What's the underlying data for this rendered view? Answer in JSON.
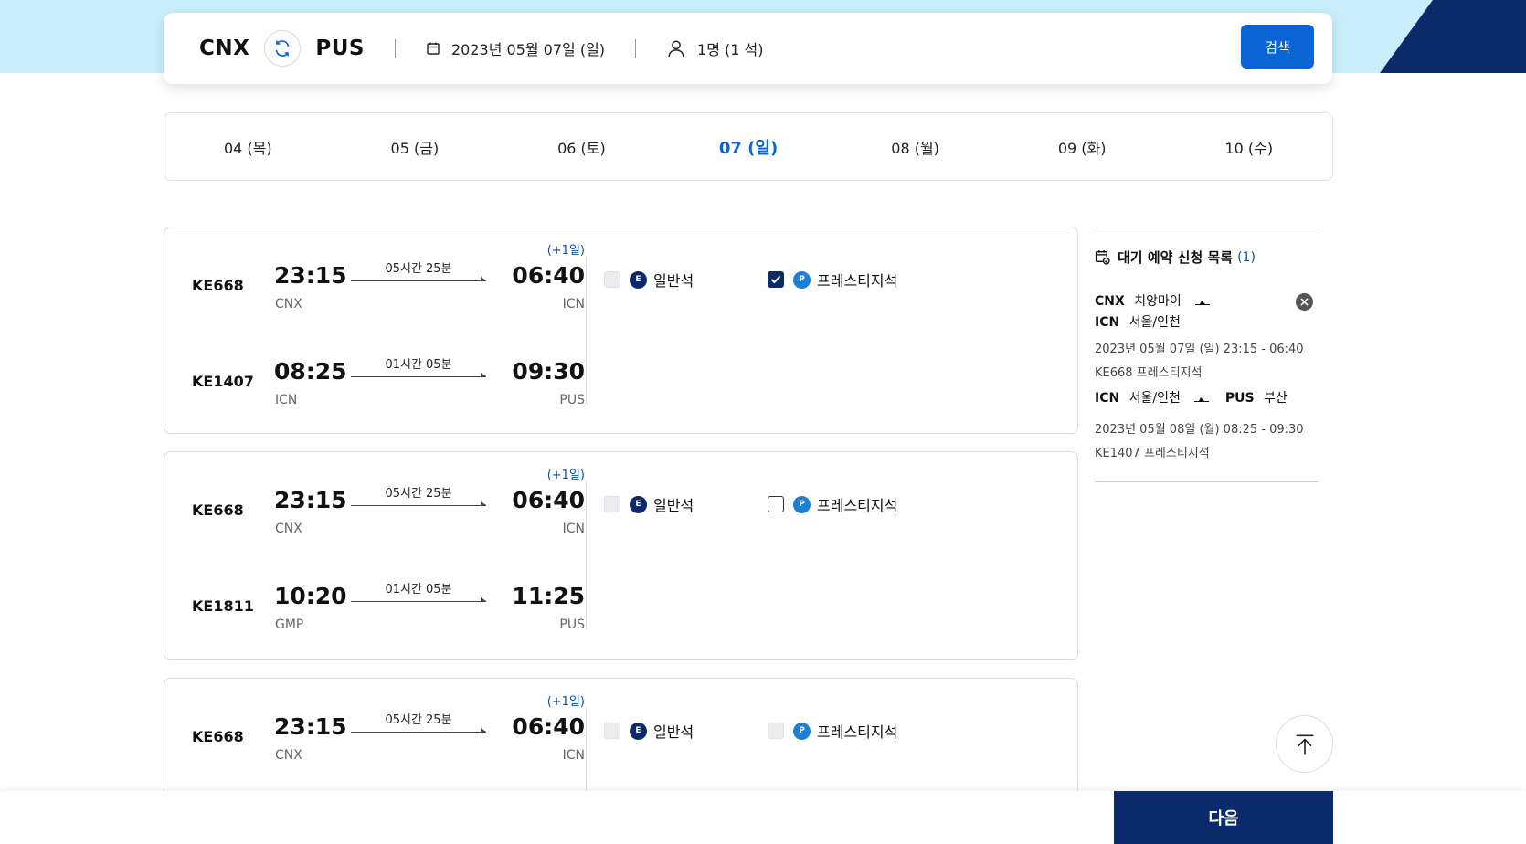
{
  "search": {
    "origin": "CNX",
    "destination": "PUS",
    "date": "2023년 05월 07일 (일)",
    "passengers": "1명 (1 석)",
    "search_label": "검색"
  },
  "date_tabs": [
    {
      "label": "04 (목)",
      "active": false
    },
    {
      "label": "05 (금)",
      "active": false
    },
    {
      "label": "06 (토)",
      "active": false
    },
    {
      "label": "07 (일)",
      "active": true
    },
    {
      "label": "08 (월)",
      "active": false
    },
    {
      "label": "09 (화)",
      "active": false
    },
    {
      "label": "10 (수)",
      "active": false
    }
  ],
  "itineraries": [
    {
      "segments": [
        {
          "flight": "KE668",
          "dep_time": "23:15",
          "dep_code": "CNX",
          "duration": "05시간 25분",
          "arr_time": "06:40",
          "arr_code": "ICN",
          "plus_day": "(+1일)"
        },
        {
          "flight": "KE1407",
          "dep_time": "08:25",
          "dep_code": "ICN",
          "duration": "01시간 05분",
          "arr_time": "09:30",
          "arr_code": "PUS",
          "plus_day": ""
        }
      ],
      "economy": {
        "badge": "E",
        "label": "일반석",
        "state": "disabled"
      },
      "prestige": {
        "badge": "P",
        "label": "프레스티지석",
        "state": "checked"
      }
    },
    {
      "segments": [
        {
          "flight": "KE668",
          "dep_time": "23:15",
          "dep_code": "CNX",
          "duration": "05시간 25분",
          "arr_time": "06:40",
          "arr_code": "ICN",
          "plus_day": "(+1일)"
        },
        {
          "flight": "KE1811",
          "dep_time": "10:20",
          "dep_code": "GMP",
          "duration": "01시간 05분",
          "arr_time": "11:25",
          "arr_code": "PUS",
          "plus_day": ""
        }
      ],
      "economy": {
        "badge": "E",
        "label": "일반석",
        "state": "disabled"
      },
      "prestige": {
        "badge": "P",
        "label": "프레스티지석",
        "state": "empty"
      }
    },
    {
      "segments": [
        {
          "flight": "KE668",
          "dep_time": "23:15",
          "dep_code": "CNX",
          "duration": "05시간 25분",
          "arr_time": "06:40",
          "arr_code": "ICN",
          "plus_day": "(+1일)"
        }
      ],
      "economy": {
        "badge": "E",
        "label": "일반석",
        "state": "disabled"
      },
      "prestige": {
        "badge": "P",
        "label": "프레스티지석",
        "state": "disabled"
      }
    }
  ],
  "waitlist": {
    "title": "대기 예약 신청 목록",
    "count": "(1)",
    "leg1_from_code": "CNX",
    "leg1_from_city": "치앙마이",
    "leg1_to_code": "ICN",
    "leg1_to_city": "서울/인천",
    "leg1_datetime": "2023년 05월 07일 (일) 23:15 - 06:40",
    "leg1_flight": "KE668 프레스티지석",
    "leg2_from_code": "ICN",
    "leg2_from_city": "서울/인천",
    "leg2_to_code": "PUS",
    "leg2_to_city": "부산",
    "leg2_datetime": "2023년 05월 08일 (월) 08:25 - 09:30",
    "leg2_flight": "KE1407 프레스티지석"
  },
  "next_label": "다음",
  "colors": {
    "brand_navy": "#0a2a6b",
    "brand_blue": "#0a64d6",
    "header_sky": "#c8eefb"
  },
  "icons": {
    "swap": "swap-icon",
    "calendar": "calendar-icon",
    "person": "person-icon",
    "waitlist": "calendar-check-icon",
    "remove": "close-circle-icon",
    "plane": "plane-icon",
    "scroll_top": "arrow-up-icon"
  }
}
